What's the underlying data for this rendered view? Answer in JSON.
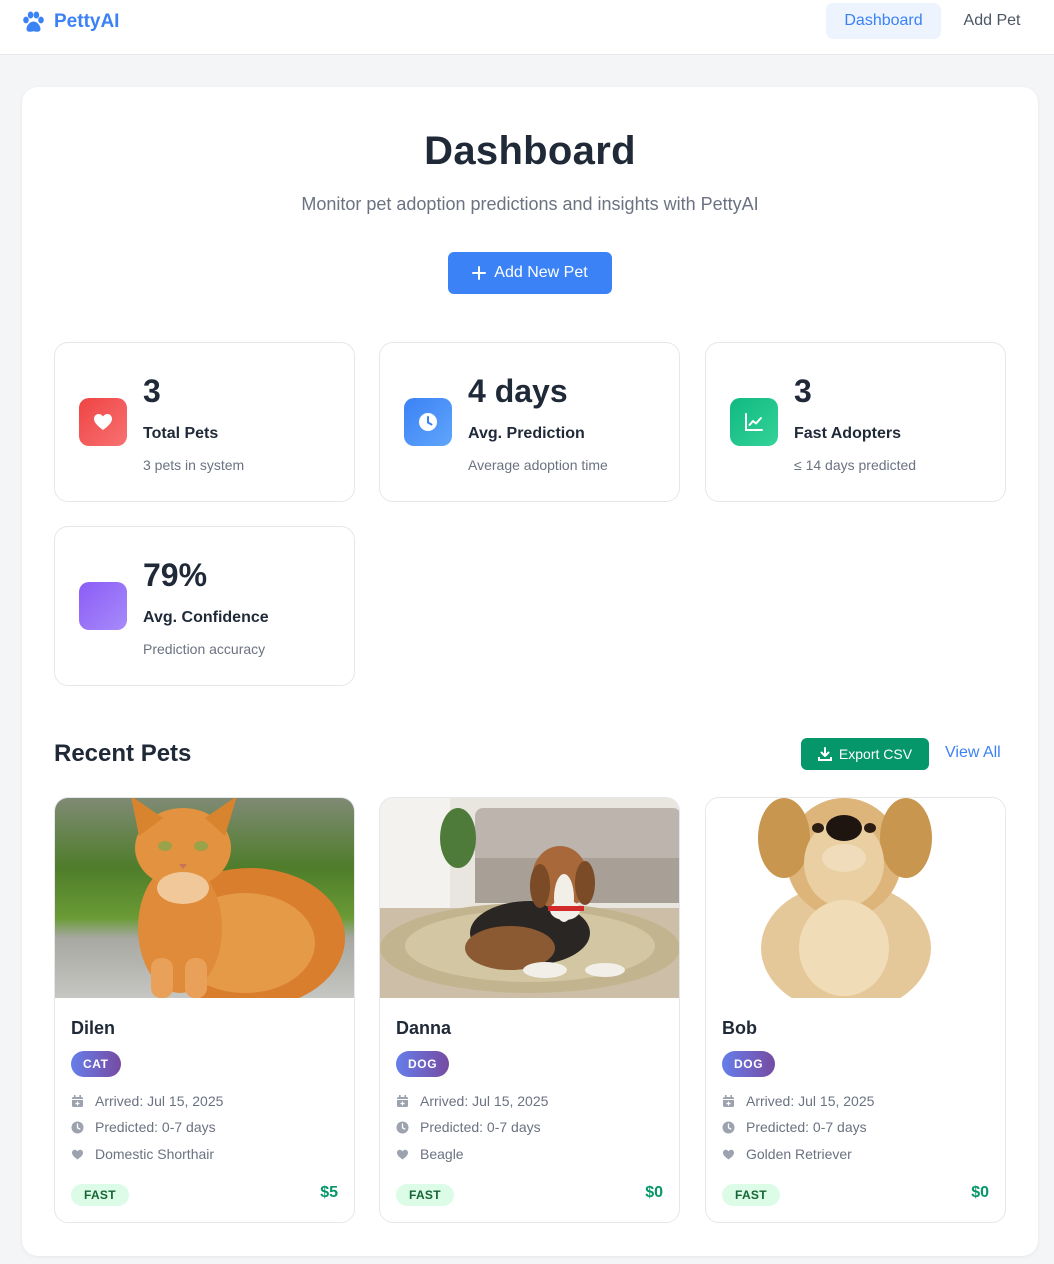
{
  "navbar": {
    "brand": "PettyAI",
    "brand_icon": "paw-icon",
    "links": [
      {
        "label": "Dashboard",
        "active": true
      },
      {
        "label": "Add Pet",
        "active": false
      }
    ]
  },
  "header": {
    "title": "Dashboard",
    "subtitle": "Monitor pet adoption predictions and insights with PettyAI",
    "add_button": "Add New Pet"
  },
  "stats": [
    {
      "value": "3",
      "label": "Total Pets",
      "sub": "3 pets in system",
      "icon": "heart-icon",
      "color": "#ef4444"
    },
    {
      "value": "4 days",
      "label": "Avg. Prediction",
      "sub": "Average adoption time",
      "icon": "clock-icon",
      "color": "#3b82f6"
    },
    {
      "value": "3",
      "label": "Fast Adopters",
      "sub": "≤ 14 days predicted",
      "icon": "chart-line-icon",
      "color": "#10b981"
    },
    {
      "value": "79%",
      "label": "Avg. Confidence",
      "sub": "Prediction accuracy",
      "icon": "",
      "color": "#8b5cf6"
    }
  ],
  "recent": {
    "title": "Recent Pets",
    "export_label": "Export CSV",
    "view_all": "View All",
    "pets": [
      {
        "name": "Dilen",
        "species": "CAT",
        "arrived": "Arrived: Jul 15, 2025",
        "predicted": "Predicted: 0-7 days",
        "breed": "Domestic Shorthair",
        "speed": "FAST",
        "fee": "$5"
      },
      {
        "name": "Danna",
        "species": "DOG",
        "arrived": "Arrived: Jul 15, 2025",
        "predicted": "Predicted: 0-7 days",
        "breed": "Beagle",
        "speed": "FAST",
        "fee": "$0"
      },
      {
        "name": "Bob",
        "species": "DOG",
        "arrived": "Arrived: Jul 15, 2025",
        "predicted": "Predicted: 0-7 days",
        "breed": "Golden Retriever",
        "speed": "FAST",
        "fee": "$0"
      }
    ]
  },
  "colors": {
    "primary": "#3b82f6",
    "success": "#059669",
    "badge_gradient": [
      "#667eea",
      "#764ba2"
    ]
  }
}
